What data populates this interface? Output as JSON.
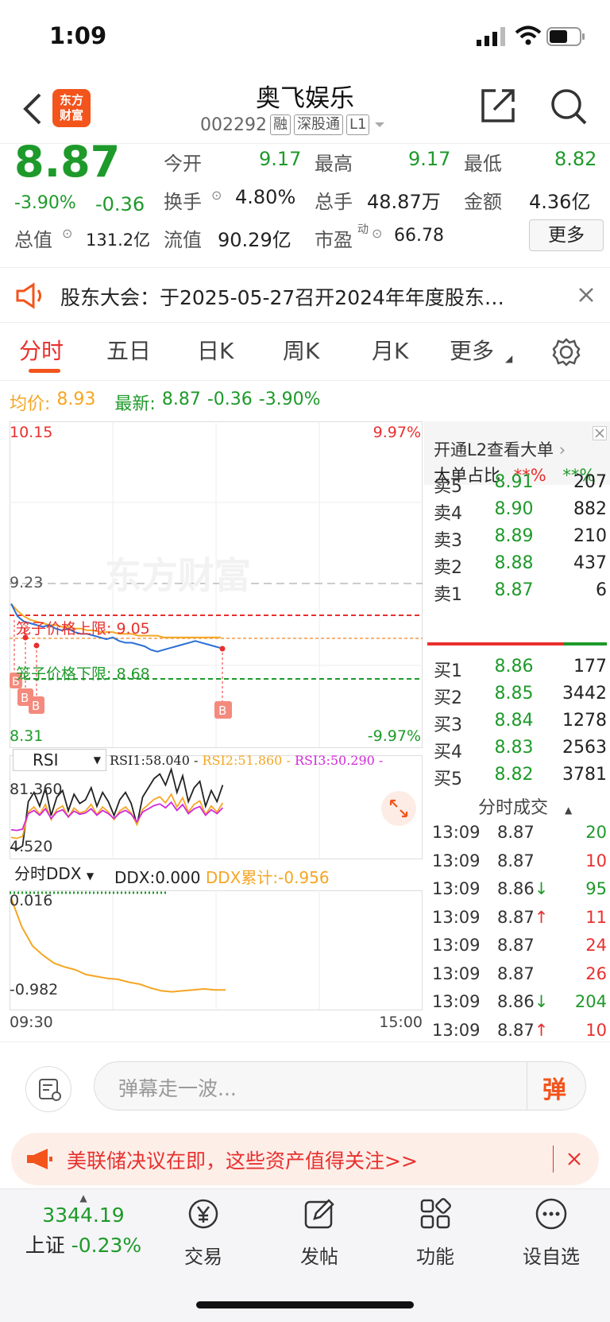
{
  "status_bar": {
    "time": "1:09"
  },
  "header": {
    "title": "奥飞娱乐",
    "code": "002292",
    "tags": [
      "融",
      "深股通",
      "L1"
    ],
    "logo_text": [
      "东方",
      "财富"
    ]
  },
  "quote": {
    "price": "8.87",
    "change_pct": "-3.90%",
    "change": "-0.36",
    "rows": [
      [
        {
          "label": "今开",
          "value": "9.17"
        },
        {
          "label": "最高",
          "value": "9.17"
        },
        {
          "label": "最低",
          "value": "8.82"
        }
      ],
      [
        {
          "label": "换手",
          "value": "4.80%"
        },
        {
          "label": "总手",
          "value": "48.87万"
        },
        {
          "label": "金额",
          "value": "4.36亿"
        }
      ],
      [
        {
          "label": "总值",
          "value": "131.2亿"
        },
        {
          "label": "流值",
          "value": "90.29亿"
        },
        {
          "label": "市盈",
          "sup": "动",
          "value": "66.78"
        }
      ]
    ],
    "more_button": "更多"
  },
  "notice": {
    "text": "股东大会：于2025-05-27召开2024年年度股东…"
  },
  "tabs": [
    "分时",
    "五日",
    "日K",
    "周K",
    "月K",
    "更多"
  ],
  "active_tab": "分时",
  "chart_summary": {
    "avg_label": "均价:",
    "avg_value": "8.93",
    "latest_label": "最新:",
    "latest_value": "8.87",
    "latest_change": "-0.36",
    "latest_pct": "-3.90%"
  },
  "chart_data": {
    "type": "line",
    "title": "",
    "price_axis": {
      "max": "10.15",
      "min": "8.31",
      "ref": "9.23",
      "max_pct": "9.97%",
      "min_pct": "-9.97%"
    },
    "x_labels": [
      "09:30",
      "15:00"
    ],
    "cage_upper": "笼子价格上限: 9.05",
    "cage_lower": "笼子价格下限: 8.68",
    "watermark": "东方财富",
    "price_series": [
      9.12,
      9.05,
      9.02,
      9.01,
      9.0,
      8.99,
      9.0,
      8.98,
      8.97,
      8.98,
      8.96,
      8.95,
      8.95,
      8.94,
      8.93,
      8.92,
      8.93,
      8.91,
      8.9,
      8.9,
      8.89,
      8.88,
      8.86,
      8.85,
      8.86,
      8.87,
      8.88,
      8.89,
      8.9,
      8.91,
      8.9,
      8.89,
      8.88,
      8.87
    ],
    "avg_series": [
      9.12,
      9.08,
      9.05,
      9.03,
      9.02,
      9.01,
      9.0,
      9.0,
      8.99,
      8.99,
      8.98,
      8.98,
      8.97,
      8.97,
      8.96,
      8.96,
      8.96,
      8.95,
      8.95,
      8.95,
      8.94,
      8.94,
      8.94,
      8.94,
      8.93,
      8.93,
      8.93,
      8.93,
      8.93,
      8.93,
      8.93,
      8.93,
      8.93,
      8.93
    ],
    "rsi": {
      "selector": "RSI",
      "rsi1": "RSI1:58.040 -",
      "rsi2": "RSI2:51.860 -",
      "rsi3": "RSI3:50.290 -",
      "max": "81.360",
      "min": "4.520"
    },
    "ddx": {
      "selector": "分时DDX",
      "ddx": "DDX:0.000",
      "ddx_sum": "DDX累计:-0.956",
      "max": "0.016",
      "min": "-0.982"
    }
  },
  "order_book": {
    "l2_text": "开通L2查看大单",
    "big_order_label": "大单占比",
    "big_red": "**%",
    "big_green": "**%",
    "asks": [
      {
        "label": "卖5",
        "price": "8.91",
        "vol": "207"
      },
      {
        "label": "卖4",
        "price": "8.90",
        "vol": "882"
      },
      {
        "label": "卖3",
        "price": "8.89",
        "vol": "210"
      },
      {
        "label": "卖2",
        "price": "8.88",
        "vol": "437"
      },
      {
        "label": "卖1",
        "price": "8.87",
        "vol": "6"
      }
    ],
    "bids": [
      {
        "label": "买1",
        "price": "8.86",
        "vol": "177"
      },
      {
        "label": "买2",
        "price": "8.85",
        "vol": "3442"
      },
      {
        "label": "买3",
        "price": "8.84",
        "vol": "1278"
      },
      {
        "label": "买4",
        "price": "8.83",
        "vol": "2563"
      },
      {
        "label": "买5",
        "price": "8.82",
        "vol": "3781"
      }
    ],
    "trades_title": "分时成交",
    "trades": [
      {
        "time": "13:09",
        "price": "8.87",
        "dir": "",
        "vol": "20",
        "vc": "green"
      },
      {
        "time": "13:09",
        "price": "8.87",
        "dir": "",
        "vol": "10",
        "vc": "red"
      },
      {
        "time": "13:09",
        "price": "8.86",
        "dir": "↓",
        "vol": "95",
        "vc": "green"
      },
      {
        "time": "13:09",
        "price": "8.87",
        "dir": "↑",
        "vol": "11",
        "vc": "red"
      },
      {
        "time": "13:09",
        "price": "8.87",
        "dir": "",
        "vol": "24",
        "vc": "red"
      },
      {
        "time": "13:09",
        "price": "8.87",
        "dir": "",
        "vol": "26",
        "vc": "red"
      },
      {
        "time": "13:09",
        "price": "8.86",
        "dir": "↓",
        "vol": "204",
        "vc": "green"
      },
      {
        "time": "13:09",
        "price": "8.87",
        "dir": "↑",
        "vol": "10",
        "vc": "red"
      }
    ]
  },
  "comment": {
    "placeholder": "弹幕走一波...",
    "danmu": "弹"
  },
  "ad": {
    "text": "美联储决议在即，这些资产值得关注>>"
  },
  "bottom_nav": {
    "index_value": "3344.19",
    "index_name": "上证",
    "index_pct": "-0.23%",
    "items": [
      "交易",
      "发帖",
      "功能",
      "设自选"
    ]
  }
}
